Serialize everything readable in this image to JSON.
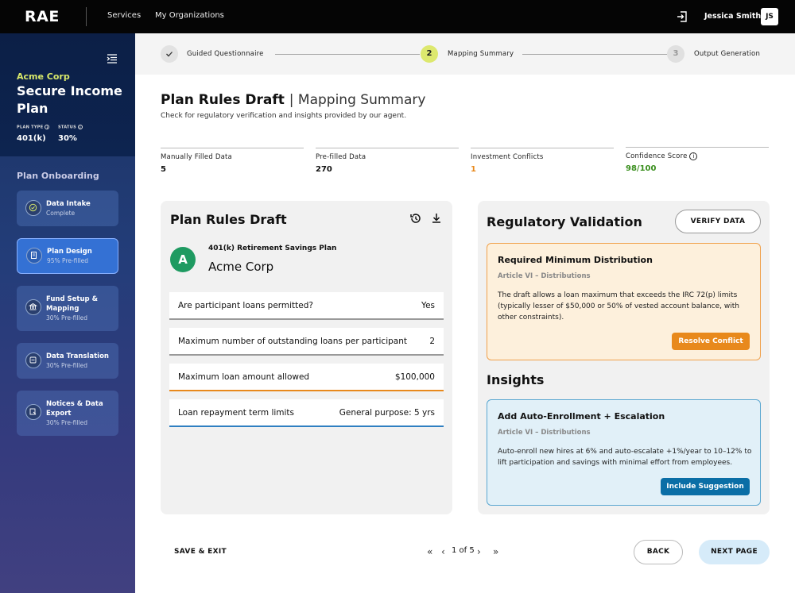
{
  "nav": {
    "logo": "RAE",
    "links": [
      "Services",
      "My Organizations"
    ],
    "user_name": "Jessica Smith",
    "user_initials": "JS"
  },
  "plan": {
    "org": "Acme Corp",
    "name": "Secure Income Plan",
    "type_label": "PLAN TYPE",
    "type_value": "401(k)",
    "status_label": "STATUS",
    "status_value": "30%"
  },
  "sidebar": {
    "section_title": "Plan Onboarding",
    "steps": [
      {
        "title": "Data Intake",
        "sub": "Complete",
        "icon": "check-badge-icon"
      },
      {
        "title": "Plan Design",
        "sub": "95% Pre-filled",
        "icon": "document-icon"
      },
      {
        "title": "Fund Setup & Mapping",
        "sub": "30% Pre-filled",
        "icon": "bank-icon"
      },
      {
        "title": "Data Translation",
        "sub": "30% Pre-filled",
        "icon": "translate-icon"
      },
      {
        "title": "Notices & Data Export",
        "sub": "30% Pre-filled",
        "icon": "export-icon"
      }
    ]
  },
  "stepper": {
    "steps": [
      {
        "num": "",
        "label": "Guided Questionnaire",
        "state": "done"
      },
      {
        "num": "2",
        "label": "Mapping Summary",
        "state": "current"
      },
      {
        "num": "3",
        "label": "Output Generation",
        "state": "pending"
      }
    ]
  },
  "header": {
    "title": "Plan Rules Draft",
    "subtitle": "| Mapping Summary",
    "description": "Check for regulatory verification and insights provided by our agent."
  },
  "stats": [
    {
      "label": "Manually Filled Data",
      "value": "5",
      "color": "#111111"
    },
    {
      "label": "Pre-filled Data",
      "value": "270",
      "color": "#111111"
    },
    {
      "label": "Investment Conflicts",
      "value": "1",
      "color": "#e8891c"
    },
    {
      "label": "Confidence Score",
      "value": "98/100",
      "color": "#3a8f1e"
    }
  ],
  "draft": {
    "title": "Plan Rules Draft",
    "avatar": "A",
    "plan_label": "401(k) Retirement Savings Plan",
    "company": "Acme Corp",
    "rules": [
      {
        "question": "Are participant loans permitted?",
        "answer": "Yes",
        "accent": "#999999"
      },
      {
        "question": "Maximum number of outstanding loans per participant",
        "answer": "2",
        "accent": "#999999"
      },
      {
        "question": "Maximum loan amount allowed",
        "answer": "$100,000",
        "accent": "#e8891c"
      },
      {
        "question": "Loan repayment term limits",
        "answer": "General purpose: 5 yrs",
        "accent": "#2f7fc1"
      }
    ]
  },
  "validation": {
    "title": "Regulatory Validation",
    "verify_label": "VERIFY DATA",
    "conflict": {
      "title": "Required Minimum Distribution",
      "article": "Article VI – Distributions",
      "body": "The draft allows a loan maximum that exceeds the IRC 72(p) limits (typically lesser of $50,000 or 50% of vested account balance, with other constraints).",
      "button": "Resolve Conflict"
    },
    "insights_title": "Insights",
    "insight": {
      "title": "Add Auto-Enrollment + Escalation",
      "article": "Article VI – Distributions",
      "body": "Auto-enroll new hires at 6% and auto-escalate +1%/year to 10–12% to lift participation and savings with minimal effort from employees.",
      "button": "Include Suggestion"
    }
  },
  "footer": {
    "save_exit": "SAVE & EXIT",
    "pagination": "1 of 5",
    "back": "BACK",
    "next": "NEXT PAGE"
  }
}
